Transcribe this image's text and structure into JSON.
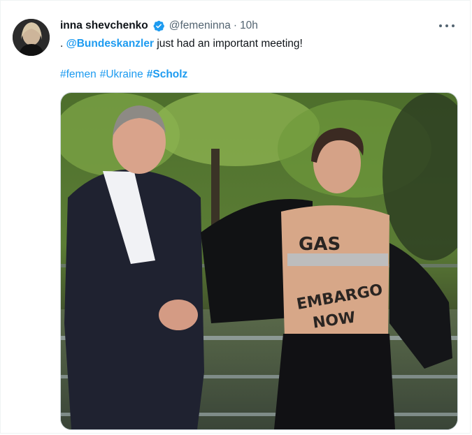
{
  "tweet": {
    "display_name": "inna shevchenko",
    "handle": "@femeninna",
    "separator": "·",
    "time": "10h",
    "text_prefix": ".",
    "mention": "@Bundeskanzler",
    "text_rest": "just had an important meeting!",
    "hashtags": [
      "#femen",
      "#Ukraine",
      "#Scholz"
    ]
  },
  "media": {
    "body_text_line1": "GAS",
    "body_text_line2": "EMBARGO",
    "body_text_line3": "NOW"
  },
  "colors": {
    "accent": "#1d9bf0",
    "secondary_text": "#536471",
    "primary_text": "#0f1419"
  },
  "icons": [
    "verified-badge-icon",
    "more-options-icon"
  ]
}
